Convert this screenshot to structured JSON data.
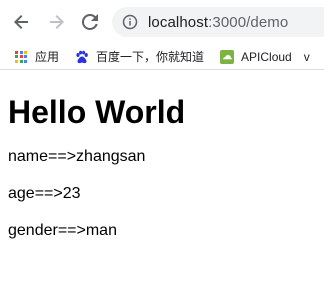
{
  "toolbar": {
    "back_icon": "arrow-left-icon",
    "forward_icon": "arrow-right-icon",
    "reload_icon": "reload-icon",
    "info_icon": "info-icon",
    "url_host": "localhost",
    "url_rest": ":3000/demo"
  },
  "bookmarks": {
    "items": [
      {
        "label": "应用",
        "icon": "apps-grid-icon"
      },
      {
        "label": "百度一下，你就知道",
        "icon": "baidu-paw-icon"
      },
      {
        "label": "APICloud",
        "icon": "apicloud-icon"
      }
    ],
    "overflow_label": "v"
  },
  "page": {
    "heading": "Hello World",
    "lines": [
      "name==>zhangsan",
      "age==>23",
      "gender==>man"
    ]
  },
  "colors": {
    "icon_gray": "#5f6368",
    "omnibox_bg": "#f1f3f4",
    "baidu_blue": "#2932e1",
    "apicloud_green": "#7cb342"
  }
}
